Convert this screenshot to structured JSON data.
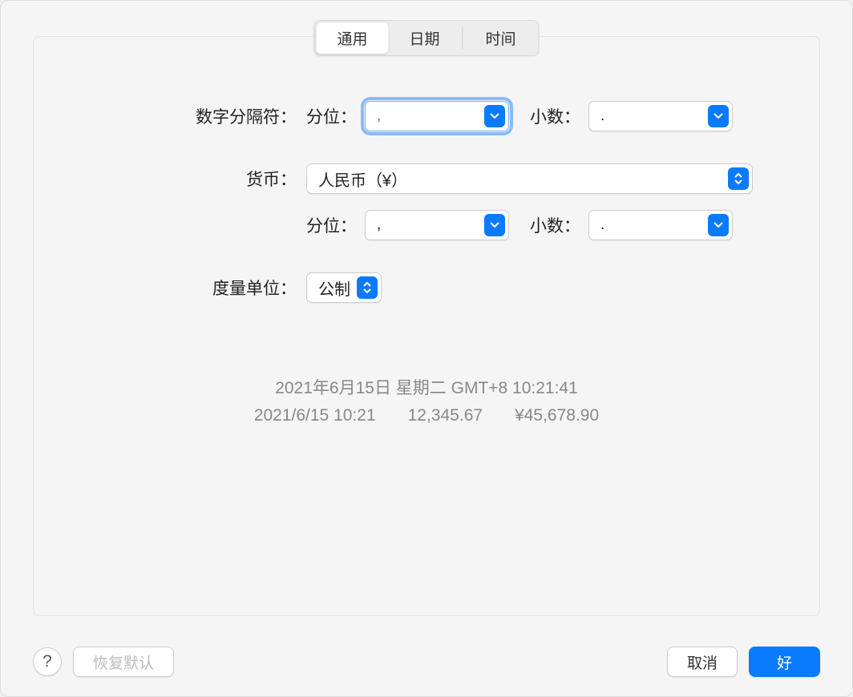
{
  "tabs": {
    "general": "通用",
    "date": "日期",
    "time": "时间"
  },
  "labels": {
    "number_separator": "数字分隔符：",
    "grouping": "分位：",
    "decimal": "小数：",
    "currency": "货币：",
    "measurement": "度量单位："
  },
  "values": {
    "number_grouping": ",",
    "number_decimal": ".",
    "currency_name": "人民币（¥）",
    "currency_grouping": ",",
    "currency_decimal": ".",
    "measurement": "公制"
  },
  "preview": {
    "line1": "2021年6月15日 星期二 GMT+8 10:21:41",
    "line2_datetime": "2021/6/15 10:21",
    "line2_number": "12,345.67",
    "line2_currency": "¥45,678.90"
  },
  "footer": {
    "help": "?",
    "restore": "恢复默认",
    "cancel": "取消",
    "ok": "好"
  }
}
